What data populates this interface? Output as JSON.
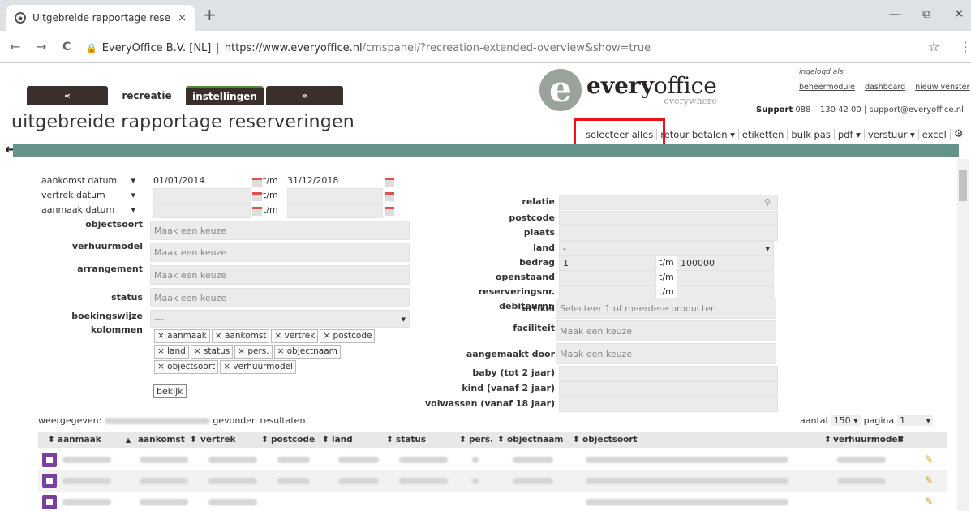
{
  "browser": {
    "tab_title": "Uitgebreide rapportage reserveri",
    "url_org": "EveryOffice B.V. [NL]",
    "url_sep": "|",
    "url_host": "https://www.everyoffice.nl",
    "url_path": "/cmspanel/?recreation-extended-overview&show=true",
    "new_tab": "+",
    "close": "×",
    "minimize": "—",
    "restore": "⧉",
    "win_close": "✕",
    "star": "☆",
    "menu": "⋮",
    "back": "←",
    "forward": "→",
    "reload": "C"
  },
  "header": {
    "tabs": [
      "«",
      "recreatie",
      "instellingen",
      "»"
    ],
    "logo_letter": "e",
    "logo_bold": "every",
    "logo_light": "office",
    "logo_tag": "everywhere",
    "login_label": "ingelogd als:",
    "links": [
      "beheermodule",
      "dashboard",
      "nieuw venster"
    ],
    "support_label": "Support",
    "support_text": "088 – 130 42 00 | support@everyoffice.nl",
    "page_title": "uitgebreide rapportage reserveringen",
    "toolbar": [
      "selecteer alles",
      "retour betalen ▾",
      "etiketten",
      "bulk pas",
      "pdf ▾",
      "verstuur ▾",
      "excel"
    ],
    "gear": "⚙",
    "back_arrow": "←"
  },
  "filters": {
    "date_rows": [
      {
        "label": "aankomst datum",
        "from": "01/01/2014",
        "tm": "t/m",
        "to": "31/12/2018"
      },
      {
        "label": "vertrek datum",
        "from": "",
        "tm": "t/m",
        "to": ""
      },
      {
        "label": "aanmaak datum",
        "from": "",
        "tm": "t/m",
        "to": ""
      }
    ],
    "caret": "▾",
    "left_fields": [
      {
        "label": "objectsoort",
        "placeholder": "Maak een keuze"
      },
      {
        "label": "verhuurmodel",
        "placeholder": "Maak een keuze"
      },
      {
        "label": "arrangement",
        "placeholder": "Maak een keuze"
      },
      {
        "label": "status",
        "placeholder": "Maak een keuze"
      }
    ],
    "boekingswijze_label": "boekingswijze",
    "boekingswijze_value": "---",
    "kolommen_label": "kolommen",
    "chips": [
      "aanmaak",
      "aankomst",
      "vertrek",
      "postcode",
      "land",
      "status",
      "pers.",
      "objectnaam",
      "objectsoort",
      "verhuurmodel"
    ],
    "bekijk": "bekijk",
    "right": {
      "relatie": "relatie",
      "postcode": "postcode",
      "plaats": "plaats",
      "land": "land",
      "land_value": "-",
      "bedrag": "bedrag",
      "bedrag_from": "1",
      "bedrag_to": "100000",
      "tm": "t/m",
      "openstaand": "openstaand",
      "reserveringsnr": "reserveringsnr.",
      "debiteurnr": "debiteurnr.",
      "artikel": "artikel",
      "artikel_ph": "Selecteer 1 of meerdere producten",
      "faciliteit": "faciliteit",
      "faciliteit_ph": "Maak een keuze",
      "aangemaakt": "aangemaakt door",
      "aangemaakt_ph": "Maak een keuze",
      "baby": "baby (tot 2 jaar)",
      "kind": "kind (vanaf 2 jaar)",
      "volwassen": "volwassen (vanaf 18 jaar)"
    }
  },
  "results": {
    "weergegeven": "weergegeven:",
    "gevonden": "gevonden resultaten.",
    "aantal_label": "aantal",
    "aantal_value": "150",
    "pagina_label": "pagina",
    "pagina_value": "1",
    "columns": [
      "aanmaak",
      "aankomst",
      "vertrek",
      "postcode",
      "land",
      "status",
      "pers.",
      "objectnaam",
      "objectsoort",
      "verhuurmodel"
    ],
    "sort_asc": "▲",
    "sort_both": "⬍"
  },
  "colors": {
    "accent_red": "#e8141b",
    "teal": "#66928c",
    "purple": "#7b3fa0",
    "tab_dark": "#3a2f2a"
  }
}
